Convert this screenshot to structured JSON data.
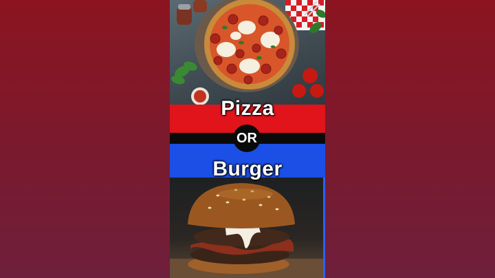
{
  "choice": {
    "option_a": "Pizza",
    "separator": "OR",
    "option_b": "Burger"
  },
  "colors": {
    "background": "#8c1420",
    "top_band": "#e0141a",
    "middle_band": "#0a0a0a",
    "bottom_band": "#1b4fe6",
    "label_text": "#ffffff"
  },
  "images": {
    "top": "pizza-photo",
    "bottom": "burger-photo"
  }
}
